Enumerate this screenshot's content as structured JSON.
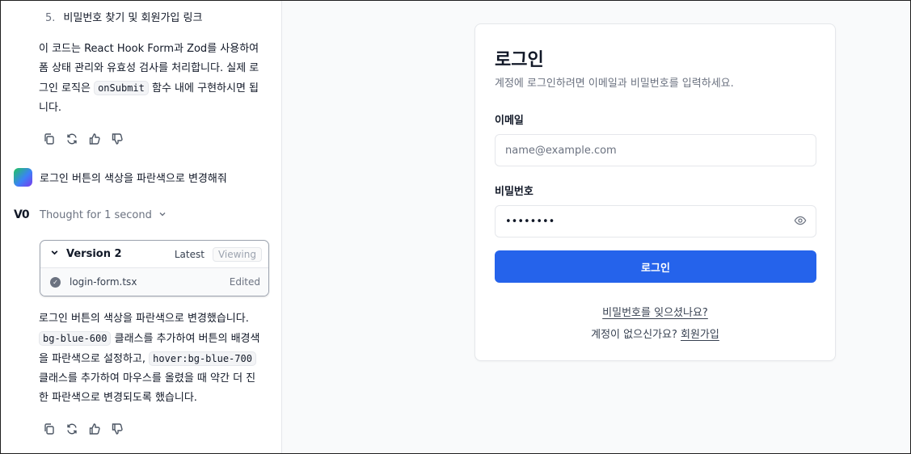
{
  "chat": {
    "list_item": {
      "number": "5.",
      "text": "비밀번호 찾기 및 회원가입 링크"
    },
    "para1": {
      "part1": "이 코드는 React Hook Form과 Zod를 사용하여 폼 상태 관리와 유효성 검사를 처리합니다. 실제 로그인 로직은 ",
      "code1": "onSubmit",
      "part2": " 함수 내에 구현하시면 됩니다."
    },
    "user_message": "로그인 버튼의 색상을 파란색으로 변경해줘",
    "thought": {
      "logo": "V0",
      "label": "Thought for 1 second"
    },
    "version": {
      "title": "Version 2",
      "latest": "Latest",
      "viewing": "Viewing",
      "file": "login-form.tsx",
      "status": "Edited"
    },
    "para2": {
      "part1": "로그인 버튼의 색상을 파란색으로 변경했습니다. ",
      "code1": "bg-blue-600",
      "part2": " 클래스를 추가하여 버튼의 배경색을 파란색으로 설정하고, ",
      "code2": "hover:bg-blue-700",
      "part3": " 클래스를 추가하여 마우스를 올렸을 때 약간 더 진한 파란색으로 변경되도록 했습니다."
    },
    "icons": [
      "copy-icon",
      "refresh-icon",
      "thumbs-up-icon",
      "thumbs-down-icon"
    ]
  },
  "login": {
    "title": "로그인",
    "description": "계정에 로그인하려면 이메일과 비밀번호를 입력하세요.",
    "email_label": "이메일",
    "email_placeholder": "name@example.com",
    "password_label": "비밀번호",
    "password_value": "••••••••",
    "submit_label": "로그인",
    "forgot_link": "비밀번호를 잊으셨나요?",
    "signup_prompt": "계정이 없으신가요? ",
    "signup_link": "회원가입"
  },
  "colors": {
    "primary_button": "#2563eb",
    "avatar_gradient": [
      "#22c55e",
      "#3b82f6",
      "#7c3aed"
    ]
  }
}
